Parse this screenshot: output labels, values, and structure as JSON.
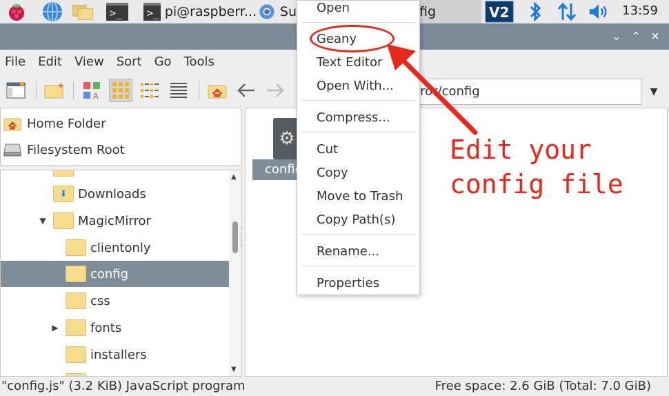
{
  "taskbar": {
    "terminal_window_label": "pi@raspberr...",
    "chromium_window_label": "Su",
    "files_window_label": "fig",
    "clock": "13:59"
  },
  "menubar": {
    "items": [
      "File",
      "Edit",
      "View",
      "Sort",
      "Go",
      "Tools"
    ]
  },
  "toolbar": {
    "path": "irror/config"
  },
  "places": [
    {
      "label": "Home Folder",
      "icon": "home-icon"
    },
    {
      "label": "Filesystem Root",
      "icon": "drive-icon"
    }
  ],
  "tree": {
    "items": [
      {
        "label": "Downloads",
        "level": 1,
        "expander": ""
      },
      {
        "label": "MagicMirror",
        "level": 1,
        "expander": "▼"
      },
      {
        "label": "clientonly",
        "level": 2,
        "expander": ""
      },
      {
        "label": "config",
        "level": 2,
        "expander": "",
        "selected": true
      },
      {
        "label": "css",
        "level": 2,
        "expander": ""
      },
      {
        "label": "fonts",
        "level": 2,
        "expander": "▶"
      },
      {
        "label": "installers",
        "level": 2,
        "expander": ""
      }
    ]
  },
  "filepane": {
    "file_label": "config.js"
  },
  "context_menu": {
    "items": [
      "Open",
      "Geany",
      "Text Editor",
      "Open With...",
      "Compress...",
      "Cut",
      "Copy",
      "Move to Trash",
      "Copy Path(s)",
      "Rename...",
      "Properties"
    ]
  },
  "statusbar": {
    "left": "\"config.js\" (3.2 KiB) JavaScript program",
    "right": "Free space: 2.6 GiB (Total: 7.0 GiB)"
  },
  "annotation": {
    "text": "Edit your\nconfig file",
    "color": "#e8281c"
  },
  "colors": {
    "selection": "#7e8d98",
    "titlebar": "#7a8a96",
    "folder": "#f6dc8c"
  }
}
